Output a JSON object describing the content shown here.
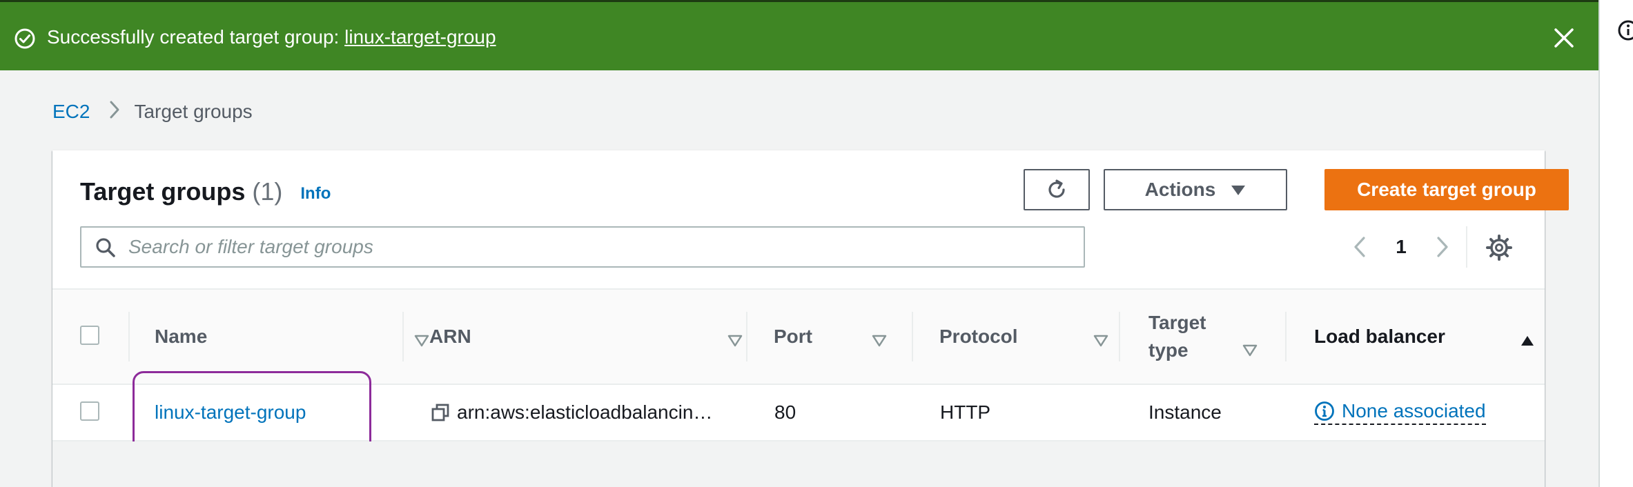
{
  "flash": {
    "message": "Successfully created target group: ",
    "link": "linux-target-group"
  },
  "breadcrumb": {
    "root": "EC2",
    "current": "Target groups"
  },
  "header": {
    "title": "Target groups",
    "count": "(1)",
    "info": "Info"
  },
  "toolbar": {
    "actions_label": "Actions",
    "create_label": "Create target group"
  },
  "search": {
    "placeholder": "Search or filter target groups",
    "value": ""
  },
  "pagination": {
    "current_page": "1"
  },
  "table": {
    "columns": [
      {
        "label": "Name",
        "sort": "none"
      },
      {
        "label": "ARN",
        "sort": "none"
      },
      {
        "label": "Port",
        "sort": "none"
      },
      {
        "label": "Protocol",
        "sort": "none"
      },
      {
        "label": "Target type",
        "sort": "none"
      },
      {
        "label": "Load balancer",
        "sort": "ascending"
      }
    ],
    "rows": [
      {
        "name": "linux-target-group",
        "arn": "arn:aws:elasticloadbalancin…",
        "port": "80",
        "protocol": "HTTP",
        "target_type": "Instance",
        "load_balancer": "None associated"
      }
    ]
  },
  "colors": {
    "success_green": "#3f8624",
    "primary_orange": "#ec7211",
    "link_blue": "#0073bb",
    "highlight_purple": "#8d2b9a"
  },
  "icons": {
    "success": "check-circle-icon",
    "close": "close-icon",
    "breadcrumb_separator": "chevron-right-icon",
    "refresh": "refresh-icon",
    "actions_caret": "caret-down-icon",
    "search": "search-icon",
    "prev": "chevron-left-icon",
    "next": "chevron-right-icon",
    "settings": "gear-icon",
    "sort": "sort-caret-icon",
    "copy": "copy-icon",
    "info": "info-icon"
  }
}
